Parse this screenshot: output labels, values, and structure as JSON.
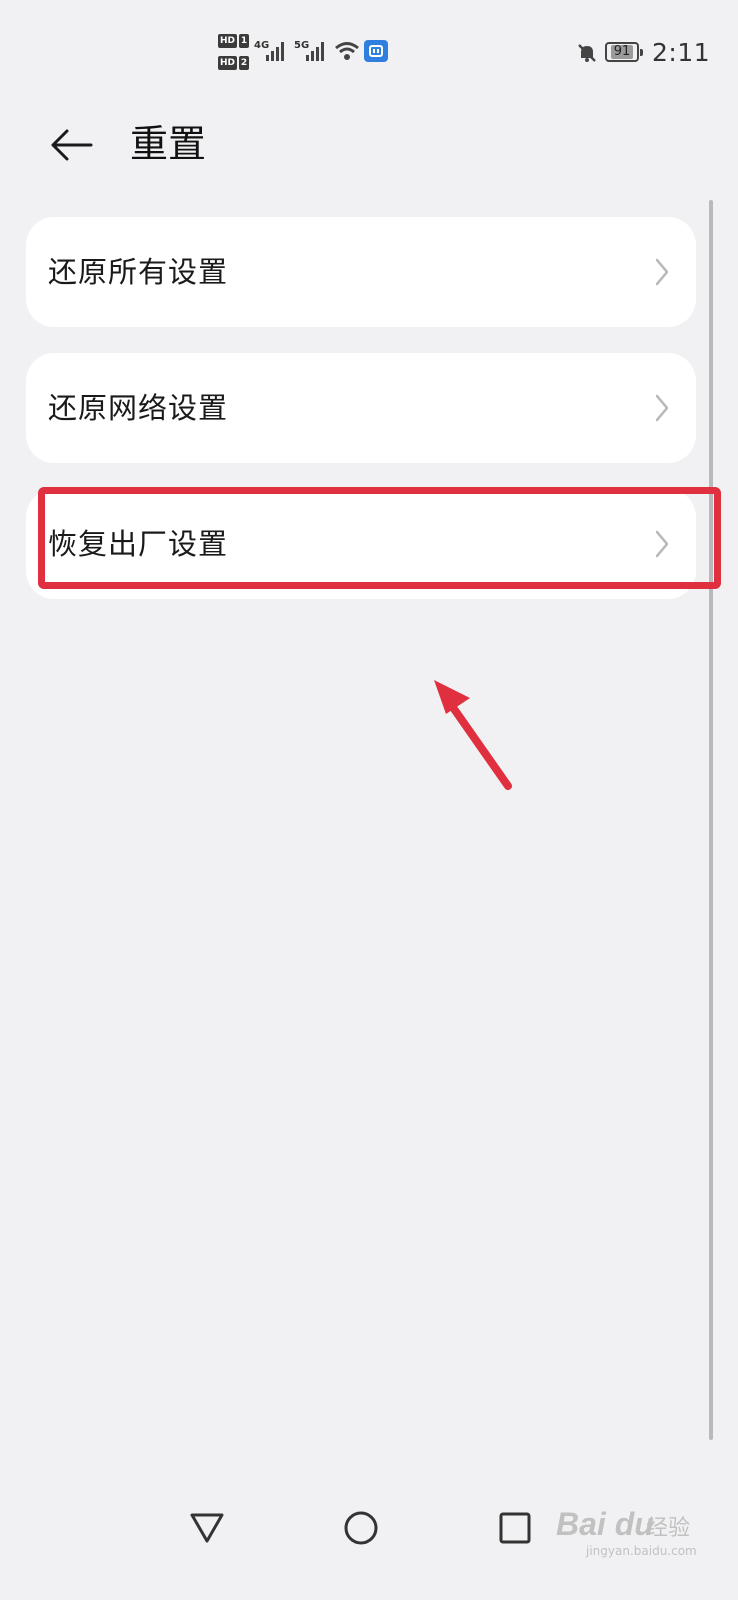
{
  "status_bar": {
    "sim1_badge": "HD",
    "sim1_num": "1",
    "sim2_badge": "HD",
    "sim2_num": "2",
    "network1_label": "4G",
    "network2_label": "5G",
    "battery_level": "91",
    "time": "2:11",
    "icons": [
      "signal-icon",
      "wifi-icon",
      "app-badge-icon",
      "bell-off-icon",
      "battery-icon"
    ]
  },
  "header": {
    "back_icon": "arrow-left-icon",
    "title": "重置"
  },
  "items": [
    {
      "label": "还原所有设置",
      "icon": "chevron-right-icon"
    },
    {
      "label": "还原网络设置",
      "icon": "chevron-right-icon"
    },
    {
      "label": "恢复出厂设置",
      "icon": "chevron-right-icon"
    }
  ],
  "annotation": {
    "highlight_color": "#e0303f",
    "highlighted_item": "恢复出厂设置"
  },
  "nav_bar": {
    "icons": [
      "back-triangle-icon",
      "home-circle-icon",
      "recents-square-icon"
    ]
  },
  "watermark": {
    "brand": "Bai du",
    "brand_cn": "经验",
    "url": "jingyan.baidu.com"
  },
  "colors": {
    "background": "#f1f1f3",
    "card": "#ffffff",
    "text": "#1a1a1a",
    "chevron": "#b8b8b8"
  }
}
